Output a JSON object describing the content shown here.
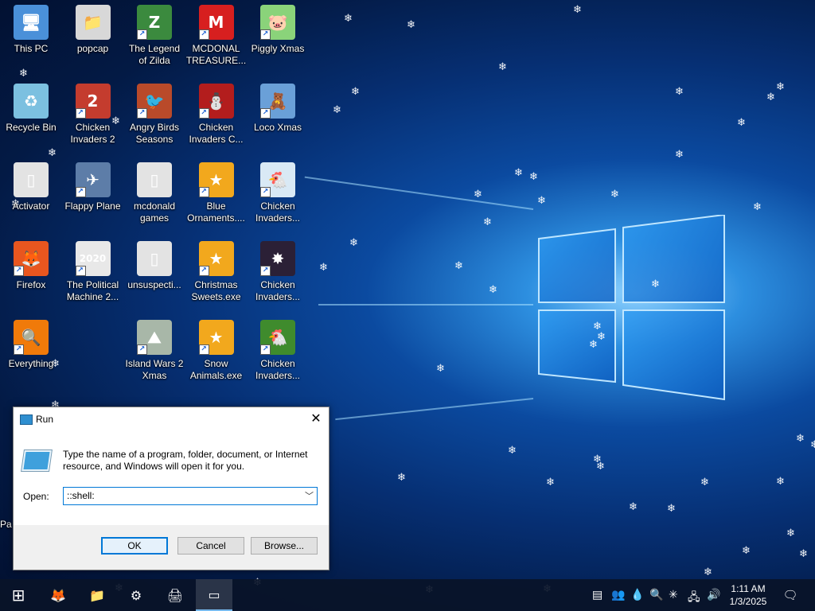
{
  "desktop": {
    "icons": [
      {
        "label": "This PC",
        "glyph": "🖥",
        "color": "#4a90d9"
      },
      {
        "label": "popcap",
        "glyph": "📁",
        "color": "#d8d8d8"
      },
      {
        "label": "The Legend of Zilda",
        "glyph": "Z",
        "color": "#3b8a3e"
      },
      {
        "label": "MCDONAL TREASURE...",
        "glyph": "M",
        "color": "#d71f1f"
      },
      {
        "label": "Piggly Xmas",
        "glyph": "🐷",
        "color": "#8ad37a"
      },
      {
        "label": "Recycle Bin",
        "glyph": "♻",
        "color": "#7cc0e0"
      },
      {
        "label": "Chicken Invaders 2",
        "glyph": "2",
        "color": "#c43c2e"
      },
      {
        "label": "Angry Birds Seasons",
        "glyph": "🐦",
        "color": "#b94a2a"
      },
      {
        "label": "Chicken Invaders C...",
        "glyph": "⛄",
        "color": "#b31d1d"
      },
      {
        "label": "Loco Xmas",
        "glyph": "🧸",
        "color": "#6aa0d8"
      },
      {
        "label": "Activator",
        "glyph": "▯",
        "color": "#e3e3e3"
      },
      {
        "label": "Flappy Plane",
        "glyph": "✈",
        "color": "#5d7da8"
      },
      {
        "label": "mcdonald games",
        "glyph": "▯",
        "color": "#e3e3e3"
      },
      {
        "label": "Blue Ornaments....",
        "glyph": "★",
        "color": "#f2a81d"
      },
      {
        "label": "Chicken Invaders...",
        "glyph": "🐔",
        "color": "#d9e9f5"
      },
      {
        "label": "Firefox",
        "glyph": "🦊",
        "color": "#e8561f"
      },
      {
        "label": "The Political Machine 2...",
        "glyph": "2020",
        "color": "#e8e8e8"
      },
      {
        "label": "unsuspecti...",
        "glyph": "▯",
        "color": "#e3e3e3"
      },
      {
        "label": "Christmas Sweets.exe",
        "glyph": "★",
        "color": "#f2a81d"
      },
      {
        "label": "Chicken Invaders...",
        "glyph": "✸",
        "color": "#2b2036"
      },
      {
        "label": "Everything",
        "glyph": "🔍",
        "color": "#f07a0a"
      },
      {
        "label": "Island Wars 2 Xmas",
        "glyph": "⛰",
        "color": "#a8b7a8"
      },
      {
        "label": "Snow Animals.exe",
        "glyph": "★",
        "color": "#f2a81d"
      },
      {
        "label": "Chicken Invaders...",
        "glyph": "🐔",
        "color": "#3f8b2d"
      }
    ],
    "partial_label": "Pa"
  },
  "run_dialog": {
    "title": "Run",
    "close": "✕",
    "description": "Type the name of a program, folder, document, or Internet resource, and Windows will open it for you.",
    "open_label": "Open:",
    "open_value": "::shell:",
    "ok": "OK",
    "cancel": "Cancel",
    "browse": "Browse..."
  },
  "taskbar": {
    "start": "⊞",
    "pinned": [
      {
        "name": "firefox",
        "glyph": "🦊"
      },
      {
        "name": "file-explorer",
        "glyph": "📁"
      },
      {
        "name": "settings",
        "glyph": "⚙"
      },
      {
        "name": "printer",
        "glyph": "🖨"
      },
      {
        "name": "run",
        "glyph": "▭"
      }
    ],
    "tray": [
      "▤",
      "👥",
      "💧",
      "🔍",
      "✳",
      "🖧",
      "🔊"
    ],
    "time": "1:11 AM",
    "date": "1/3/2025",
    "notifications": "🗨"
  }
}
